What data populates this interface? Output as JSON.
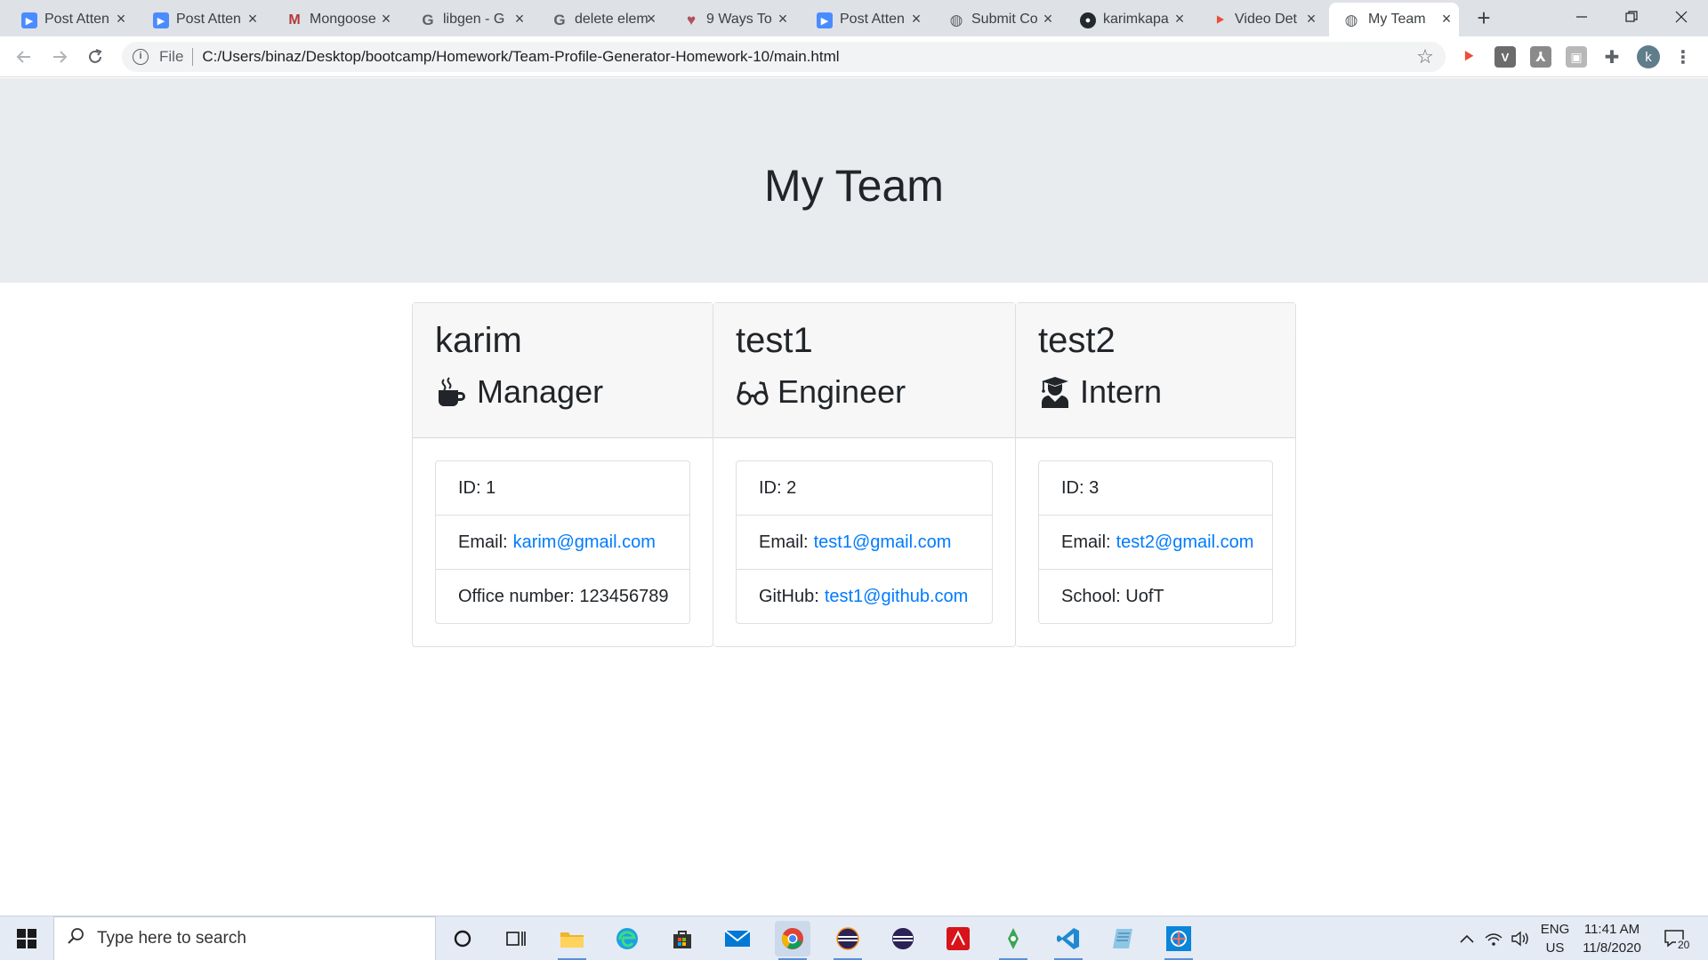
{
  "browser": {
    "tabs": [
      {
        "label": "Post Atten",
        "icon": "zoom-icon"
      },
      {
        "label": "Post Atten",
        "icon": "zoom-icon"
      },
      {
        "label": "Mongoose",
        "icon": "gmail-icon"
      },
      {
        "label": "libgen - G",
        "icon": "google-icon"
      },
      {
        "label": "delete elem",
        "icon": "google-icon"
      },
      {
        "label": "9 Ways To",
        "icon": "heart-icon"
      },
      {
        "label": "Post Atten",
        "icon": "zoom-icon"
      },
      {
        "label": "Submit Co",
        "icon": "globe-icon"
      },
      {
        "label": "karimkapa",
        "icon": "github-icon"
      },
      {
        "label": "Video Det",
        "icon": "video-icon"
      },
      {
        "label": "My Team",
        "icon": "globe-icon"
      }
    ],
    "address": {
      "scheme_label": "File",
      "url": "C:/Users/binaz/Desktop/bootcamp/Homework/Team-Profile-Generator-Homework-10/main.html"
    },
    "profile_initial": "k",
    "extensions": [
      {
        "name": "screencastify-extension-icon",
        "glyph": "⯈",
        "color": "#e94e3c"
      },
      {
        "name": "vimium-extension-icon",
        "glyph": "V",
        "color": "#6b6b6b"
      },
      {
        "name": "acrobat-extension-icon",
        "glyph": "⅄",
        "color": "#8a8a8a"
      },
      {
        "name": "wallet-extension-icon",
        "glyph": "▣",
        "color": "#9a9a9a"
      }
    ]
  },
  "page": {
    "title": "My Team",
    "team": [
      {
        "name": "karim",
        "role": "Manager",
        "role_icon": "mug-icon",
        "id_label": "ID:",
        "id": "1",
        "email_label": "Email:",
        "email": "karim@gmail.com",
        "extra_label": "Office number:",
        "extra_value": "123456789",
        "extra_is_link": false
      },
      {
        "name": "test1",
        "role": "Engineer",
        "role_icon": "glasses-icon",
        "id_label": "ID:",
        "id": "2",
        "email_label": "Email:",
        "email": "test1@gmail.com",
        "extra_label": "GitHub:",
        "extra_value": "test1@github.com",
        "extra_is_link": true
      },
      {
        "name": "test2",
        "role": "Intern",
        "role_icon": "graduate-icon",
        "id_label": "ID:",
        "id": "3",
        "email_label": "Email:",
        "email": "test2@gmail.com",
        "extra_label": "School:",
        "extra_value": "UofT",
        "extra_is_link": false
      }
    ]
  },
  "taskbar": {
    "search_placeholder": "Type here to search",
    "language": "ENG",
    "region": "US",
    "time": "11:41 AM",
    "date": "11/8/2020",
    "notification_count": "20"
  },
  "colors": {
    "jumbotron_bg": "#e9ecef",
    "link": "#007bff",
    "card_header_bg": "#f7f7f7"
  }
}
